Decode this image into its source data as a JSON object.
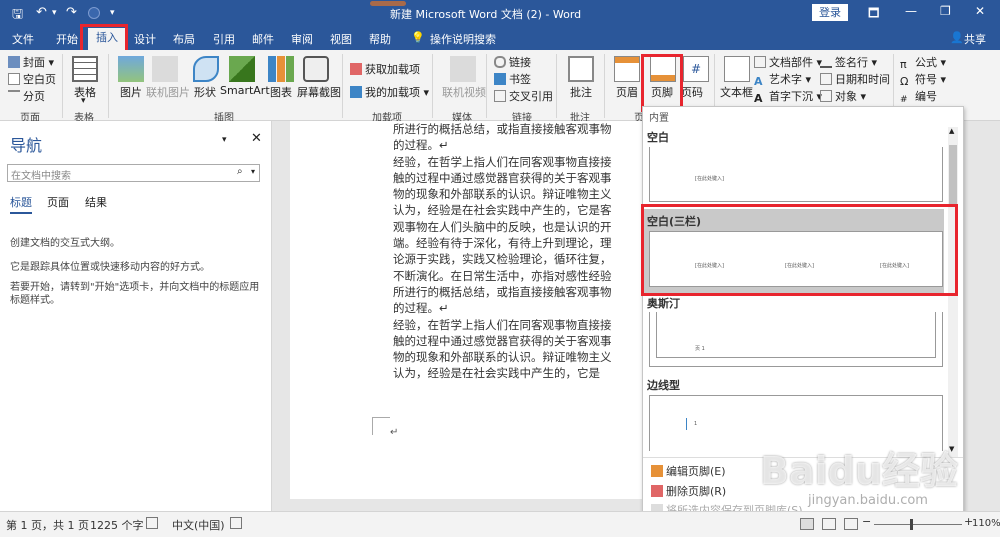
{
  "titlebar": {
    "title": "新建 Microsoft Word 文档 (2)  -  Word",
    "login": "登录",
    "restore_glyph": "🗖",
    "min_glyph": "—",
    "max_glyph": "❐",
    "close_glyph": "✕",
    "save_glyph": "🖫",
    "undo_glyph": "↶",
    "redo_glyph": "↷"
  },
  "tabs": [
    "文件",
    "开始",
    "插入",
    "设计",
    "布局",
    "引用",
    "邮件",
    "审阅",
    "视图",
    "帮助",
    "操作说明搜索"
  ],
  "share": "共享",
  "ribbon": {
    "pages": {
      "items": [
        "封面",
        "空白页",
        "分页"
      ],
      "group": "页面"
    },
    "table": {
      "label": "表格",
      "group": "表格"
    },
    "illustrations": {
      "items": [
        "图片",
        "联机图片",
        "形状",
        "SmartArt",
        "图表",
        "屏幕截图"
      ],
      "group": "插图"
    },
    "addins": {
      "items": [
        "获取加载项",
        "我的加载项"
      ],
      "group": "加载项"
    },
    "media": {
      "label": "联机视频",
      "group": "媒体"
    },
    "links": {
      "items": [
        "链接",
        "书签",
        "交叉引用"
      ],
      "group": "链接"
    },
    "comments": {
      "label": "批注",
      "group": "批注"
    },
    "headerfooter": {
      "items": [
        "页眉",
        "页脚",
        "页码"
      ],
      "group": "页"
    },
    "text": {
      "items": [
        "文本框",
        "文档部件",
        "艺术字",
        "首字下沉",
        "签名行",
        "日期和时间",
        "对象"
      ]
    },
    "symbols": {
      "items": [
        "公式",
        "符号",
        "编号"
      ]
    }
  },
  "nav": {
    "title": "导航",
    "search_placeholder": "在文档中搜索",
    "tabs": [
      "标题",
      "页面",
      "结果"
    ],
    "lines": [
      "创建文档的交互式大纲。",
      "它是跟踪具体位置或快速移动内容的好方式。",
      "若要开始，请转到\"开始\"选项卡，并向文档中的标题应用标题样式。"
    ]
  },
  "document": {
    "paragraphs": [
      "所进行的概括总结，或指直接接触客观事物的过程。↵",
      "经验，在哲学上指人们在同客观事物直接接触的过程中通过感觉器官获得的关于客观事物的现象和外部联系的认识。辩证唯物主义认为，经验是在社会实践中产生的，它是客观事物在人们头脑中的反映，也是认识的开端。经验有待于深化，有待上升到理论，理论源于实践，实践又检验理论，循环往复，不断演化。在日常生活中，亦指对感性经验所进行的概括总结，或指直接接触客观事物的过程。↵",
      "经验，在哲学上指人们在同客观事物直接接触的过程中通过感觉器官获得的关于客观事物的现象和外部联系的认识。辩证唯物主义认为，经验是在社会实践中产生的，它是"
    ],
    "end_mark": "↵"
  },
  "gallery": {
    "top_label": "内置",
    "sections": [
      {
        "title": "空白",
        "placeholders": [
          "[在此处键入]"
        ]
      },
      {
        "title": "空白(三栏)",
        "placeholders": [
          "[在此处键入]",
          "[在此处键入]",
          "[在此处键入]"
        ]
      },
      {
        "title": "奥斯汀",
        "placeholders": [
          "页 1"
        ]
      },
      {
        "title": "边线型",
        "placeholders": [
          "1"
        ]
      }
    ],
    "menu": [
      "编辑页脚(E)",
      "删除页脚(R)",
      "将所选内容保存到页脚库(S)..."
    ]
  },
  "status": {
    "page": "第 1 页，共 1 页",
    "words": "1225 个字",
    "lang": "中文(中国)",
    "zoom": "110%"
  },
  "watermark": {
    "brand": "Baidu经验",
    "url": "jingyan.baidu.com"
  },
  "colors": {
    "accent": "#2b579a",
    "highlight": "#e8252e"
  }
}
